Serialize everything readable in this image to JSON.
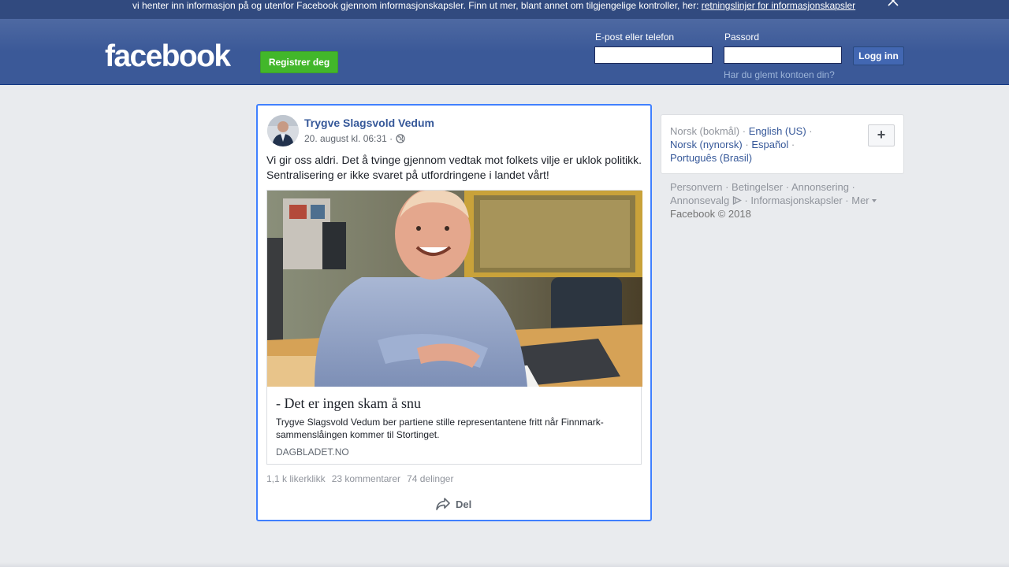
{
  "cookie_bar": {
    "text": "vi henter inn informasjon på og utenfor Facebook gjennom informasjonskapsler. Finn ut mer, blant annet om tilgjengelige kontroller, her: ",
    "link": "retningslinjer for informasjonskapsler"
  },
  "header": {
    "logo": "facebook",
    "register_label": "Registrer deg",
    "email_label": "E-post eller telefon",
    "password_label": "Passord",
    "email_value": "",
    "password_value": "",
    "login_label": "Logg inn",
    "forgot_label": "Har du glemt kontoen din?"
  },
  "post": {
    "author": "Trygve Slagsvold Vedum",
    "timestamp": "20. august kl. 06:31 ·",
    "text_line1": "Vi gir oss aldri. Det å tvinge gjennom vedtak mot folkets vilje er uklok politikk.",
    "text_line2": "Sentralisering er ikke svaret på utfordringene i landet vårt!",
    "link": {
      "title": "- Det er ingen skam å snu",
      "description": "Trygve Slagsvold Vedum ber partiene stille representantene fritt når Finnmark-sammenslåingen kommer til Stortinget.",
      "domain": "DAGBLADET.NO"
    },
    "stats": {
      "likes": "1,1 k likerklikk",
      "comments": "23 kommentarer",
      "shares": "74 delinger"
    },
    "share_label": "Del"
  },
  "sidebar": {
    "languages": [
      {
        "label": "Norsk (bokmål)",
        "current": true
      },
      {
        "label": "English (US)",
        "current": false
      },
      {
        "label": "Norsk (nynorsk)",
        "current": false
      },
      {
        "label": "Español",
        "current": false
      },
      {
        "label": "Português (Brasil)",
        "current": false
      }
    ],
    "add_language_label": "+",
    "footer": {
      "personvern": "Personvern",
      "betingelser": "Betingelser",
      "annonsering": "Annonsering",
      "annonsevalg": "Annonsevalg",
      "informasjonskapsler": "Informasjonskapsler",
      "mer": "Mer",
      "copyright": "Facebook © 2018"
    }
  },
  "colors": {
    "brand_blue": "#3b5998",
    "link_blue": "#365899",
    "register_green": "#42b72a",
    "focus_border": "#4080ff"
  }
}
